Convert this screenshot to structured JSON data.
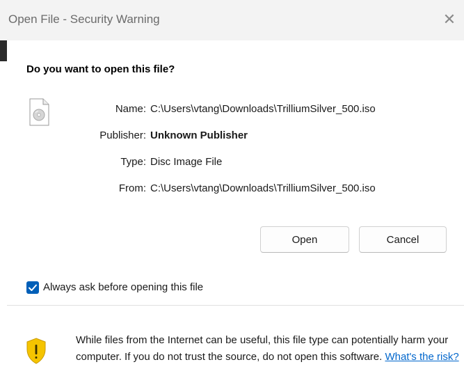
{
  "window": {
    "title": "Open File - Security Warning",
    "close_glyph": "✕"
  },
  "prompt": {
    "question": "Do you want to open this file?"
  },
  "file_icon": "disc-image-file-icon",
  "file_info": {
    "name_label": "Name:",
    "name_value": "C:\\Users\\vtang\\Downloads\\TrilliumSilver_500.iso",
    "publisher_label": "Publisher:",
    "publisher_value": "Unknown Publisher",
    "type_label": "Type:",
    "type_value": "Disc Image File",
    "from_label": "From:",
    "from_value": "C:\\Users\\vtang\\Downloads\\TrilliumSilver_500.iso"
  },
  "buttons": {
    "open_label": "Open",
    "cancel_label": "Cancel"
  },
  "always_ask": {
    "checked": true,
    "label": "Always ask before opening this file"
  },
  "warning": {
    "icon": "shield-warning-icon",
    "text": "While files from the Internet can be useful, this file type can potentially harm your computer. If you do not trust the source, do not open this software.",
    "link_text": "What's the risk?"
  },
  "colors": {
    "checkbox_accent": "#005fb8",
    "link": "#0066cc",
    "shield_yellow": "#f5c400"
  }
}
